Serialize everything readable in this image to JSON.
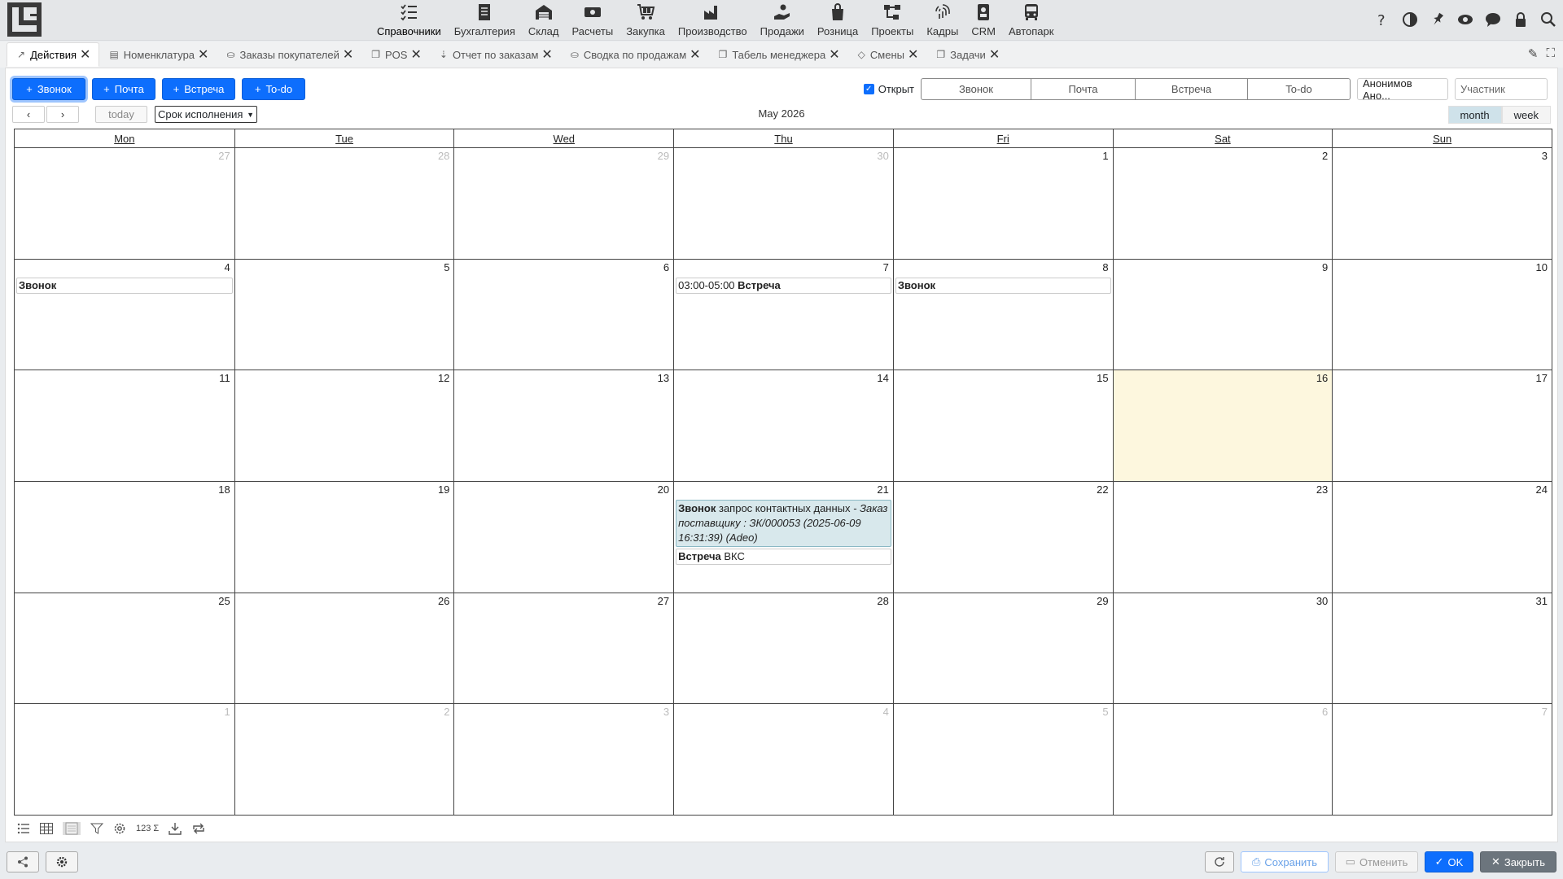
{
  "nav": [
    {
      "label": "Справочники",
      "icon": "checklist-icon",
      "active": true
    },
    {
      "label": "Бухгалтерия",
      "icon": "document-icon"
    },
    {
      "label": "Склад",
      "icon": "warehouse-icon"
    },
    {
      "label": "Расчеты",
      "icon": "money-icon"
    },
    {
      "label": "Закупка",
      "icon": "cart-icon"
    },
    {
      "label": "Производство",
      "icon": "factory-icon"
    },
    {
      "label": "Продажи",
      "icon": "hand-coin-icon"
    },
    {
      "label": "Розница",
      "icon": "bag-icon"
    },
    {
      "label": "Проекты",
      "icon": "diagram-icon"
    },
    {
      "label": "Кадры",
      "icon": "fingerprint-icon"
    },
    {
      "label": "CRM",
      "icon": "id-card-icon"
    },
    {
      "label": "Автопарк",
      "icon": "bus-icon"
    }
  ],
  "tabs": [
    {
      "label": "Действия",
      "active": true
    },
    {
      "label": "Номенклатура"
    },
    {
      "label": "Заказы покупателей"
    },
    {
      "label": "POS"
    },
    {
      "label": "Отчет по заказам"
    },
    {
      "label": "Сводка по продажам"
    },
    {
      "label": "Табель менеджера"
    },
    {
      "label": "Смены"
    },
    {
      "label": "Задачи"
    }
  ],
  "actions": {
    "add_buttons": [
      "Звонок",
      "Почта",
      "Встреча",
      "To-do"
    ],
    "open_label": "Открыт",
    "filter_types": [
      "Звонок",
      "Почта",
      "Встреча",
      "To-do"
    ],
    "user_value": "Анонимов Ано...",
    "participant_placeholder": "Участник"
  },
  "calendar": {
    "prev": "‹",
    "next": "›",
    "today_label": "today",
    "date_field": "Срок исполнения",
    "title": "May 2026",
    "views": [
      "month",
      "week"
    ],
    "active_view": "month",
    "weekdays": [
      "Mon",
      "Tue",
      "Wed",
      "Thu",
      "Fri",
      "Sat",
      "Sun"
    ],
    "days": [
      {
        "n": "27",
        "other": true
      },
      {
        "n": "28",
        "other": true
      },
      {
        "n": "29",
        "other": true
      },
      {
        "n": "30",
        "other": true
      },
      {
        "n": "1"
      },
      {
        "n": "2"
      },
      {
        "n": "3"
      },
      {
        "n": "4",
        "events": [
          {
            "title": "Звонок"
          }
        ]
      },
      {
        "n": "5"
      },
      {
        "n": "6"
      },
      {
        "n": "7",
        "events": [
          {
            "time": "03:00-05:00",
            "title": "Встреча"
          }
        ]
      },
      {
        "n": "8",
        "events": [
          {
            "title": "Звонок"
          }
        ]
      },
      {
        "n": "9"
      },
      {
        "n": "10"
      },
      {
        "n": "11"
      },
      {
        "n": "12"
      },
      {
        "n": "13"
      },
      {
        "n": "14"
      },
      {
        "n": "15"
      },
      {
        "n": "16",
        "today": true
      },
      {
        "n": "17"
      },
      {
        "n": "18"
      },
      {
        "n": "19"
      },
      {
        "n": "20"
      },
      {
        "n": "21",
        "events": [
          {
            "title": "Звонок",
            "text": "запрос контактных данных",
            "italic": " - Заказ поставщику : ЗК/000053 (2025-06-09 16:31:39) (Adeo)",
            "highlight": true
          },
          {
            "title": "Встреча",
            "text": "ВКС"
          }
        ]
      },
      {
        "n": "22"
      },
      {
        "n": "23"
      },
      {
        "n": "24"
      },
      {
        "n": "25"
      },
      {
        "n": "26"
      },
      {
        "n": "27"
      },
      {
        "n": "28"
      },
      {
        "n": "29"
      },
      {
        "n": "30"
      },
      {
        "n": "31"
      },
      {
        "n": "1",
        "other": true
      },
      {
        "n": "2",
        "other": true
      },
      {
        "n": "3",
        "other": true
      },
      {
        "n": "4",
        "other": true
      },
      {
        "n": "5",
        "other": true
      },
      {
        "n": "6",
        "other": true
      },
      {
        "n": "7",
        "other": true
      }
    ]
  },
  "toolbar_bottom": {
    "counter_label": "123",
    "sum_label": "Σ"
  },
  "footer": {
    "save": "Сохранить",
    "cancel": "Отменить",
    "ok": "OK",
    "close": "Закрыть"
  },
  "colors": {
    "primary": "#0d6efd",
    "today_bg": "#fdf7de",
    "event_highlight": "#d8e8ec"
  }
}
